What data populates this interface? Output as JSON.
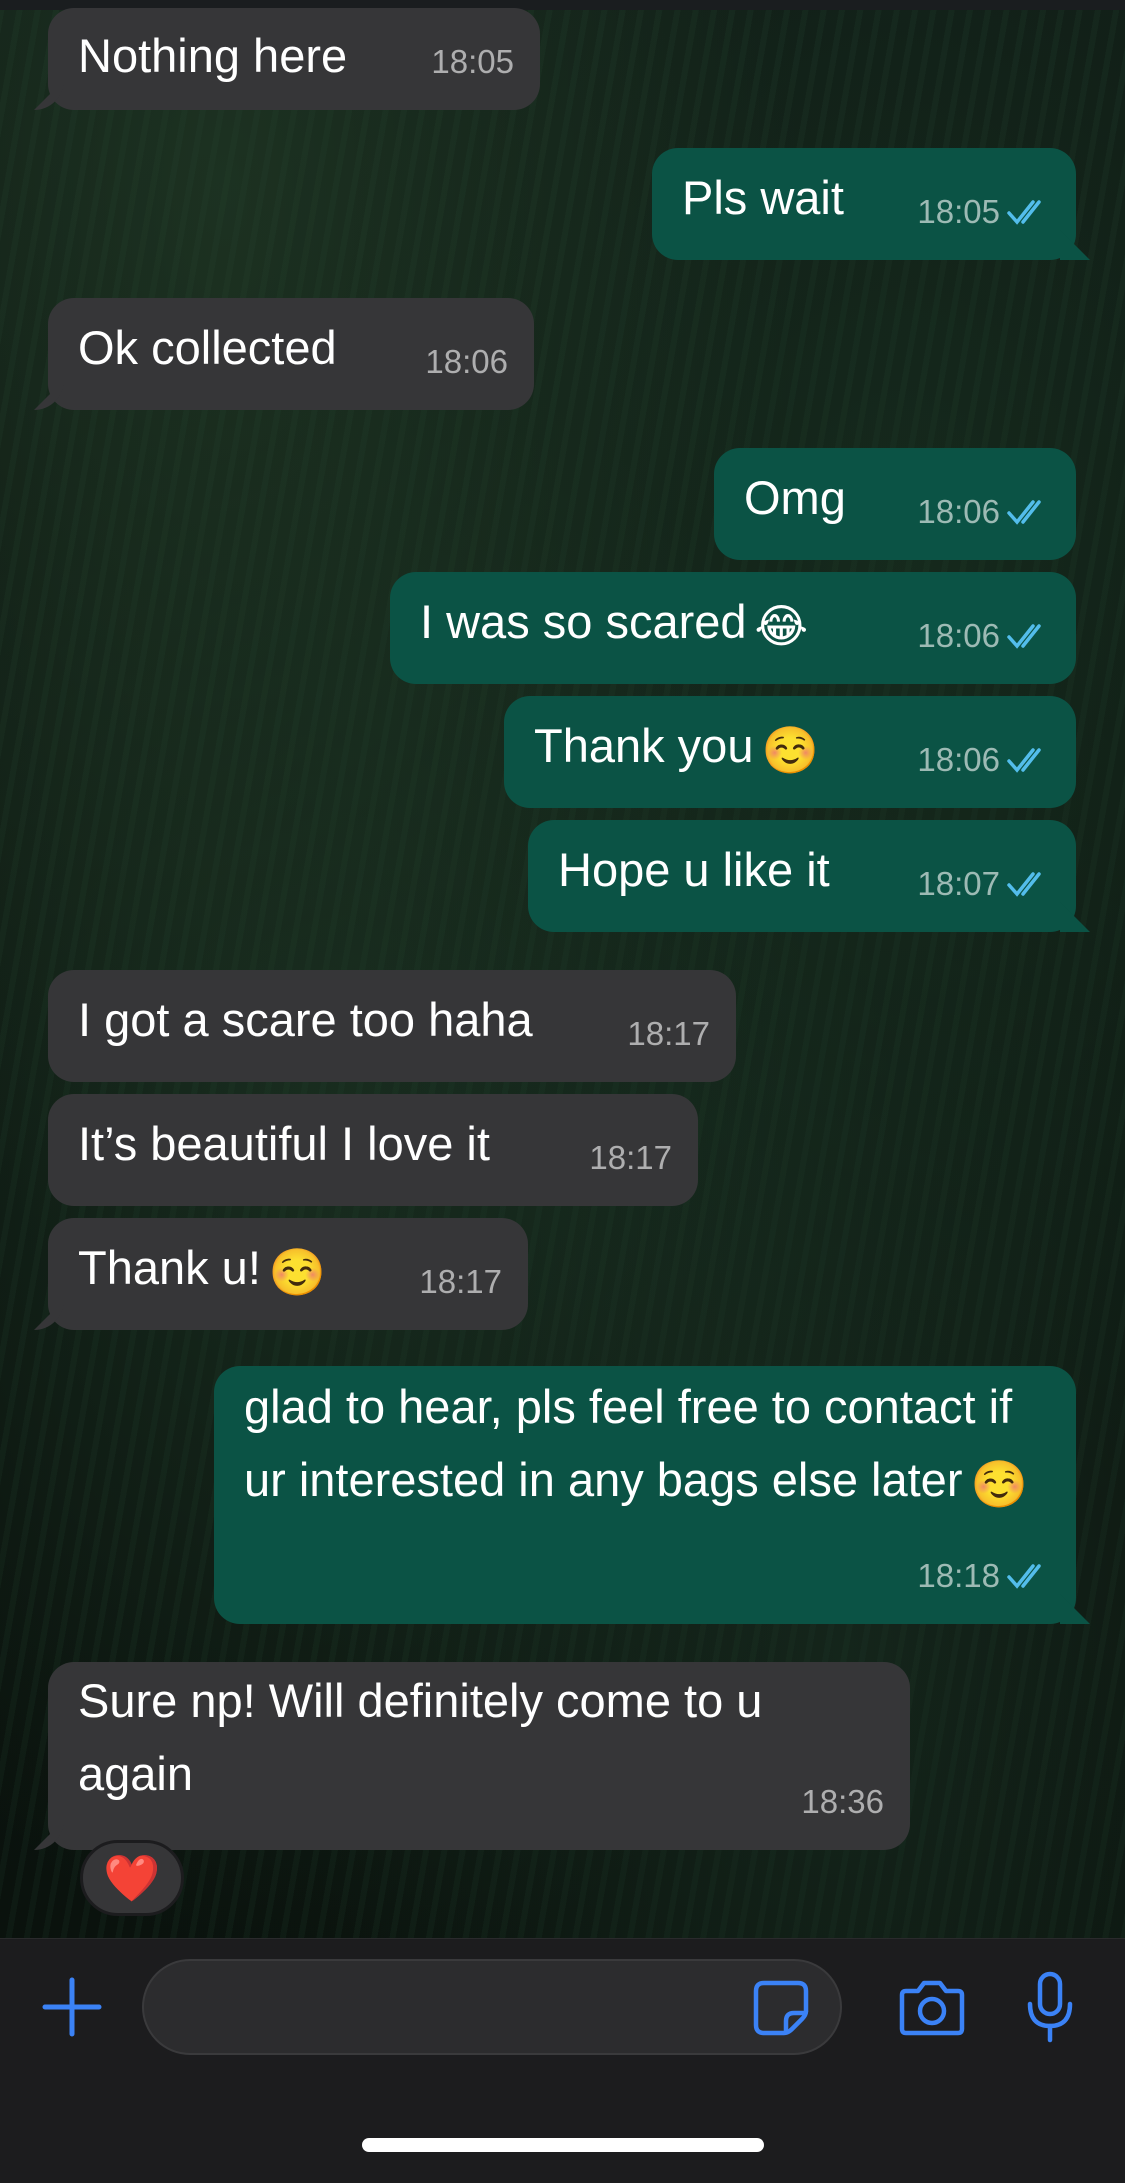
{
  "messages": [
    {
      "dir": "in",
      "text": "Nothing here",
      "time": "18:05"
    },
    {
      "dir": "out",
      "text": "Pls wait",
      "time": "18:05"
    },
    {
      "dir": "in",
      "text": "Ok collected",
      "time": "18:06"
    },
    {
      "dir": "out",
      "text": "Omg",
      "time": "18:06"
    },
    {
      "dir": "out",
      "text": "I was so scared",
      "emoji": "😂",
      "time": "18:06"
    },
    {
      "dir": "out",
      "text": "Thank you",
      "emoji": "☺️",
      "time": "18:06"
    },
    {
      "dir": "out",
      "text": "Hope u like it",
      "time": "18:07"
    },
    {
      "dir": "in",
      "text": "I got a scare too haha",
      "time": "18:17"
    },
    {
      "dir": "in",
      "text": "It’s beautiful I love it",
      "time": "18:17"
    },
    {
      "dir": "in",
      "text": "Thank u!",
      "emoji": "☺️",
      "time": "18:17"
    },
    {
      "dir": "out",
      "text": "glad to hear, pls feel free to contact if ur interested in any bags else later",
      "emoji": "☺️",
      "time": "18:18"
    },
    {
      "dir": "in",
      "text": "Sure np! Will definitely come to u again",
      "time": "18:36"
    }
  ],
  "reaction": "❤️",
  "composer": {
    "placeholder": "",
    "icons": [
      "plus-icon",
      "sticker-icon",
      "camera-icon",
      "microphone-icon"
    ]
  },
  "colors": {
    "incoming_bubble": "#363638",
    "outgoing_bubble": "#0b5345",
    "read_ticks": "#53bdeb",
    "accent": "#3b82f6"
  }
}
